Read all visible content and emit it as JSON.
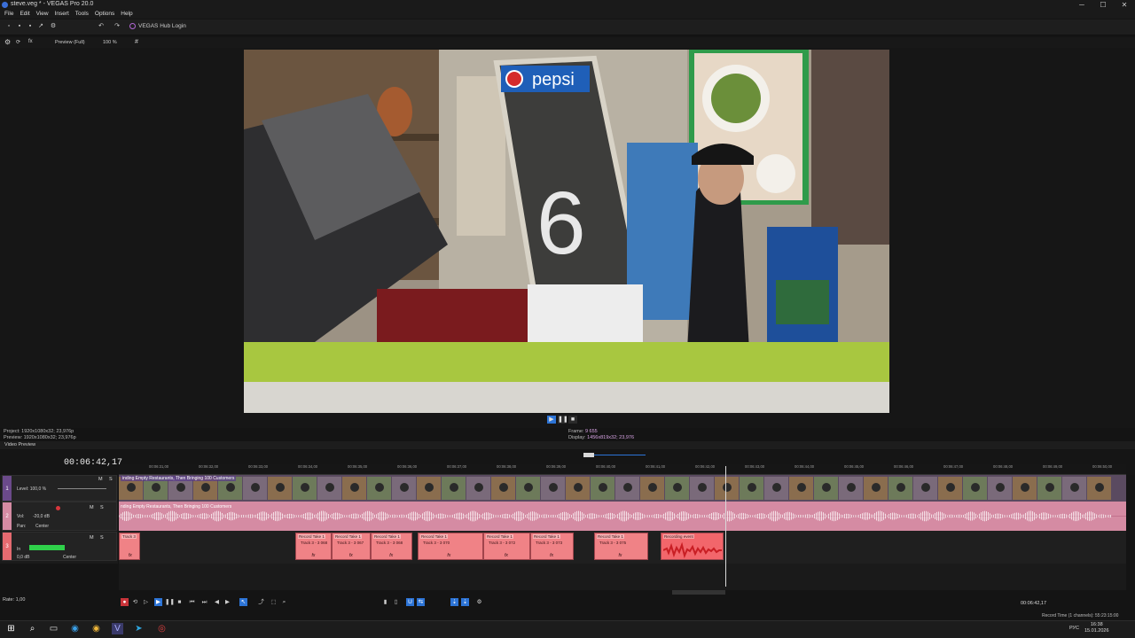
{
  "window": {
    "title": "steve.veg * - VEGAS Pro 20.0",
    "minimize": "─",
    "maximize": "☐",
    "close": "✕"
  },
  "menu": [
    "File",
    "Edit",
    "View",
    "Insert",
    "Tools",
    "Options",
    "Help"
  ],
  "toolbar": {
    "hub_label": "VEGAS Hub Login"
  },
  "preview_toolbar": {
    "quality": "Preview (Full)",
    "zoom": "100 %"
  },
  "preview_info": {
    "project": "Project:  1920x1080x32; 23,976p",
    "preview": "Preview:  1920x1080x32; 23,976p",
    "frame_label": "Frame:",
    "frame_value": "9 655",
    "display_label": "Display:",
    "display_value": "1456x819x32; 23,976"
  },
  "video_preview_tab": "Video Preview",
  "timeline": {
    "timecode": "00:06:42,17",
    "ruler_ticks": [
      "00:06:31,00",
      "00:06:32,00",
      "00:06:33,00",
      "00:06:34,00",
      "00:06:35,00",
      "00:06:36,00",
      "00:06:37,00",
      "00:06:38,00",
      "00:06:39,00",
      "00:06:40,00",
      "00:06:41,00",
      "00:06:42,00",
      "00:06:43,00",
      "00:06:44,00",
      "00:06:45,00",
      "00:06:46,00",
      "00:06:47,00",
      "00:06:48,00",
      "00:06:49,00",
      "00:06:50,00"
    ],
    "video_track": {
      "number": "1",
      "level": "Level: 100,0 %",
      "clip_title": "inding Empty Restaurants, Then Bringing 100 Customers"
    },
    "audio_track": {
      "number": "2",
      "vol": "Vol:",
      "vol_value": "-20,0 dB",
      "pan": "Pan:",
      "pan_value": "Center",
      "clip_title": "nding Empty Restaurants, Then Bringing 100 Customers"
    },
    "record_track": {
      "number": "3",
      "in_label": "In",
      "db_value": "0,0 dB",
      "pan_value": "Center",
      "clips": [
        {
          "cap": "Track 3",
          "sub": ""
        },
        {
          "cap": "Record Take 1",
          "sub": "Track 3 - 3 068"
        },
        {
          "cap": "Record Take 1",
          "sub": "Track 3 - 3 067"
        },
        {
          "cap": "Record Take 1",
          "sub": "Track 3 - 3 068"
        },
        {
          "cap": "Record Take 1",
          "sub": "Track 3 - 3 070"
        },
        {
          "cap": "Record Take 1",
          "sub": "Track 3 - 3 072"
        },
        {
          "cap": "Record Take 1",
          "sub": "Track 3 - 3 073"
        },
        {
          "cap": "Record Take 1",
          "sub": "Track 3 - 3 075"
        },
        {
          "cap": "Recording event",
          "sub": ""
        }
      ]
    },
    "rate": "Rate: 1,00",
    "tc_right": "00:06:42,17",
    "record_time": "Record Time (1 channels): 55:23:15:00"
  },
  "taskbar": {
    "lang": "РУС",
    "time": "16:38",
    "date": "15.01.2026"
  },
  "colors": {
    "accent": "#2d74d6",
    "video_track": "#6b4a8a",
    "audio_track": "#d58ba3",
    "record_clip": "#f08286"
  }
}
